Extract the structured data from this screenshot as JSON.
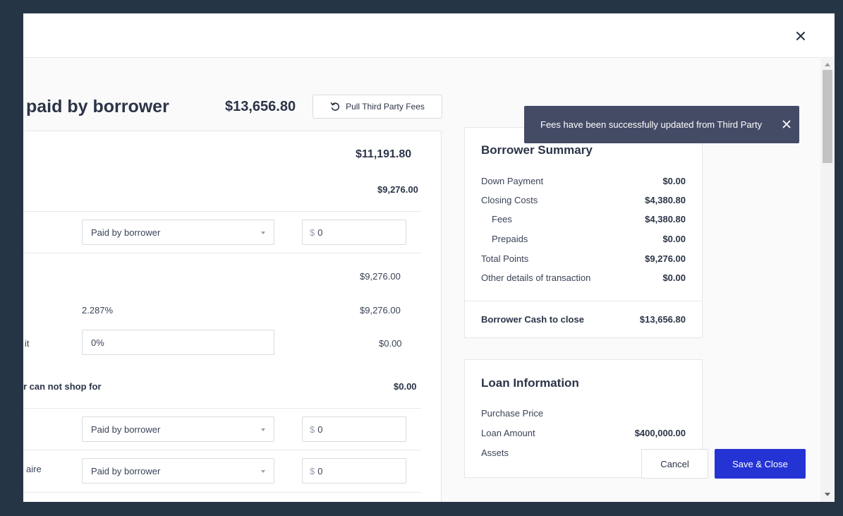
{
  "section": {
    "title": "paid by borrower",
    "total": "$13,656.80",
    "pull_button_label": "Pull Third Party Fees"
  },
  "left_card": {
    "header_total": "$11,191.80",
    "sub_total": "$9,276.00",
    "row1": {
      "select_value": "Paid by borrower",
      "currency_symbol": "$",
      "amount_value": "0"
    },
    "points_total": "$9,276.00",
    "points_rate": "2.287%",
    "points_amount": "$9,276.00",
    "credit_label": "it",
    "credit_input_value": "0%",
    "credit_amount": "$0.00",
    "cannot_shop_label": "r can not shop for",
    "cannot_shop_amount": "$0.00",
    "row2": {
      "select_value": "Paid by borrower",
      "currency_symbol": "$",
      "amount_value": "0"
    },
    "row3": {
      "label": "aire",
      "select_value": "Paid by borrower",
      "currency_symbol": "$",
      "amount_value": "0"
    }
  },
  "borrower_summary": {
    "title": "Borrower Summary",
    "rows": [
      {
        "label": "Down Payment",
        "value": "$0.00"
      },
      {
        "label": "Closing Costs",
        "value": "$4,380.80"
      },
      {
        "label": "Fees",
        "value": "$4,380.80"
      },
      {
        "label": "Prepaids",
        "value": "$0.00"
      },
      {
        "label": "Total Points",
        "value": "$9,276.00"
      },
      {
        "label": "Other details of transaction",
        "value": "$0.00"
      }
    ],
    "cash_to_close_label": "Borrower Cash to close",
    "cash_to_close_value": "$13,656.80"
  },
  "loan_information": {
    "title": "Loan Information",
    "rows": [
      {
        "label": "Purchase Price",
        "value": ""
      },
      {
        "label": "Loan Amount",
        "value": "$400,000.00"
      },
      {
        "label": "Assets",
        "value": ""
      }
    ]
  },
  "toast": {
    "message": "Fees have been successfully updated from Third Party"
  },
  "footer": {
    "cancel_label": "Cancel",
    "save_label": "Save & Close"
  },
  "colors": {
    "accent": "#2433d4",
    "toast_bg": "#444b65",
    "backdrop": "#253545"
  },
  "icons": [
    "close-icon",
    "refresh-icon",
    "chevron-down-icon",
    "toast-close-icon"
  ]
}
